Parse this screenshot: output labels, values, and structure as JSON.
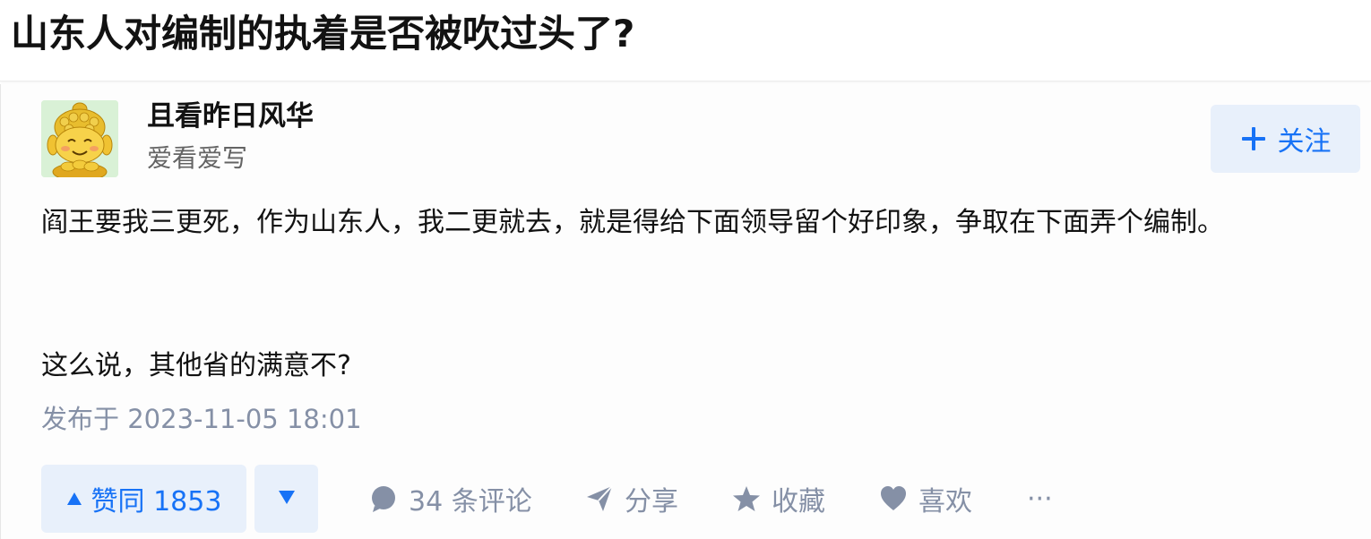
{
  "question": {
    "title": "山东人对编制的执着是否被吹过头了?"
  },
  "answer": {
    "author": {
      "name": "且看昨日风华",
      "headline": "爱看爱写",
      "avatar_icon": "golden-buddha-cartoon-avatar"
    },
    "follow_label": "关注",
    "content": {
      "p1": "阎王要我三更死，作为山东人，我二更就去，就是得给下面领导留个好印象，争取在下面弄个编制。",
      "p2": "这么说，其他省的满意不?"
    },
    "publish_time": "发布于 2023-11-05 18:01",
    "actions": {
      "vote_up": "赞同 1853",
      "comments": "34 条评论",
      "share": "分享",
      "favorite": "收藏",
      "like": "喜欢",
      "more": "···"
    }
  },
  "colors": {
    "accent": "#1772f6",
    "accent_bg": "#e8f0fb",
    "muted": "#8590a6",
    "text": "#121212"
  }
}
